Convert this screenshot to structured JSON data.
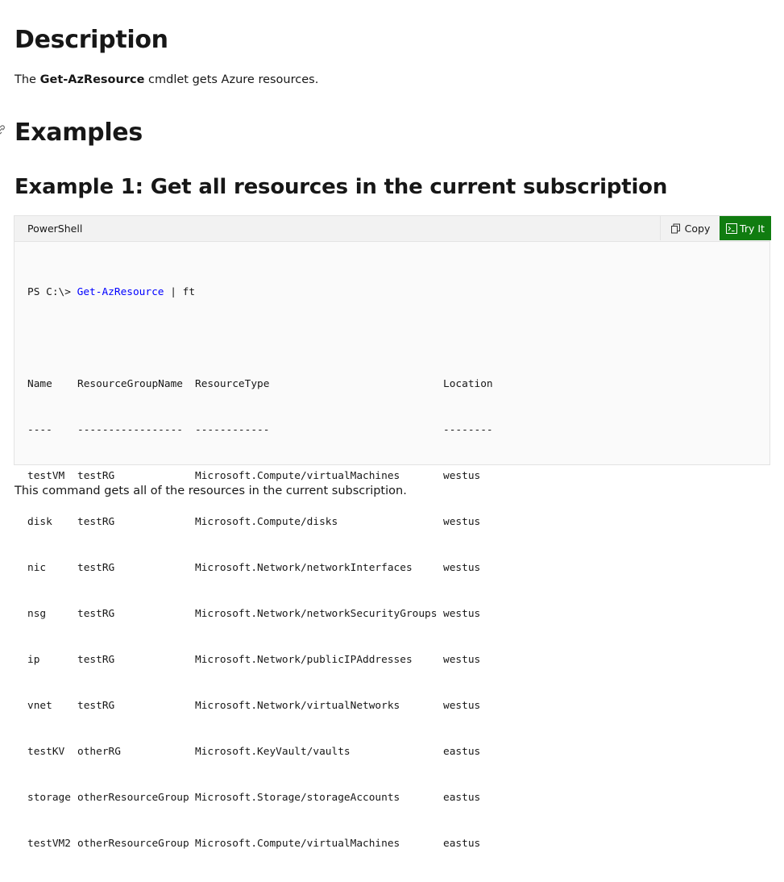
{
  "description": {
    "heading": "Description",
    "text_before": "The ",
    "cmdlet_name": "Get-AzResource",
    "text_after": " cmdlet gets Azure resources."
  },
  "examples": {
    "heading": "Examples"
  },
  "example1": {
    "heading": "Example 1: Get all resources in the current subscription",
    "code_block": {
      "language": "PowerShell",
      "copy_label": "Copy",
      "tryit_label": "Try It",
      "prompt": "PS C:\\> ",
      "command": "Get-AzResource",
      "pipe": " | ft",
      "columns": [
        "Name",
        "ResourceGroupName",
        "ResourceType",
        "Location"
      ],
      "separators": [
        "----",
        "-----------------",
        "------------",
        "--------"
      ],
      "rows": [
        [
          "testVM",
          "testRG",
          "Microsoft.Compute/virtualMachines",
          "westus"
        ],
        [
          "disk",
          "testRG",
          "Microsoft.Compute/disks",
          "westus"
        ],
        [
          "nic",
          "testRG",
          "Microsoft.Network/networkInterfaces",
          "westus"
        ],
        [
          "nsg",
          "testRG",
          "Microsoft.Network/networkSecurityGroups",
          "westus"
        ],
        [
          "ip",
          "testRG",
          "Microsoft.Network/publicIPAddresses",
          "westus"
        ],
        [
          "vnet",
          "testRG",
          "Microsoft.Network/virtualNetworks",
          "westus"
        ],
        [
          "testKV",
          "otherRG",
          "Microsoft.KeyVault/vaults",
          "eastus"
        ],
        [
          "storage",
          "otherResourceGroup",
          "Microsoft.Storage/storageAccounts",
          "eastus"
        ],
        [
          "testVM2",
          "otherResourceGroup",
          "Microsoft.Compute/virtualMachines",
          "eastus"
        ]
      ]
    },
    "explanation": "This command gets all of the resources in the current subscription."
  },
  "colors": {
    "try_it_bg": "#107c10",
    "command_text": "#0000ff",
    "code_bg": "#fafafa"
  },
  "icons": {
    "copy": "copy-icon",
    "try_it": "terminal-icon",
    "anchor": "link-anchor-icon"
  }
}
